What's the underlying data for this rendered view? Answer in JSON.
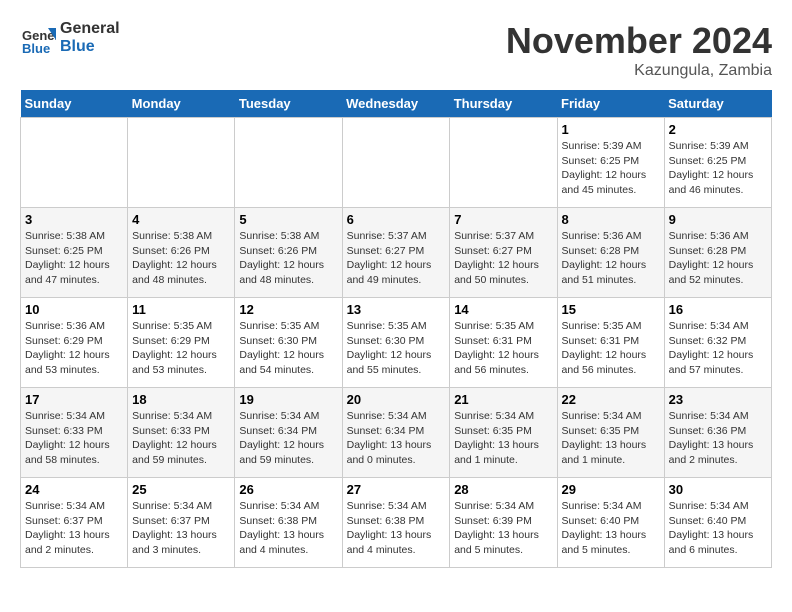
{
  "header": {
    "logo_line1": "General",
    "logo_line2": "Blue",
    "month": "November 2024",
    "location": "Kazungula, Zambia"
  },
  "weekdays": [
    "Sunday",
    "Monday",
    "Tuesday",
    "Wednesday",
    "Thursday",
    "Friday",
    "Saturday"
  ],
  "weeks": [
    [
      {
        "day": "",
        "info": ""
      },
      {
        "day": "",
        "info": ""
      },
      {
        "day": "",
        "info": ""
      },
      {
        "day": "",
        "info": ""
      },
      {
        "day": "",
        "info": ""
      },
      {
        "day": "1",
        "info": "Sunrise: 5:39 AM\nSunset: 6:25 PM\nDaylight: 12 hours\nand 45 minutes."
      },
      {
        "day": "2",
        "info": "Sunrise: 5:39 AM\nSunset: 6:25 PM\nDaylight: 12 hours\nand 46 minutes."
      }
    ],
    [
      {
        "day": "3",
        "info": "Sunrise: 5:38 AM\nSunset: 6:25 PM\nDaylight: 12 hours\nand 47 minutes."
      },
      {
        "day": "4",
        "info": "Sunrise: 5:38 AM\nSunset: 6:26 PM\nDaylight: 12 hours\nand 48 minutes."
      },
      {
        "day": "5",
        "info": "Sunrise: 5:38 AM\nSunset: 6:26 PM\nDaylight: 12 hours\nand 48 minutes."
      },
      {
        "day": "6",
        "info": "Sunrise: 5:37 AM\nSunset: 6:27 PM\nDaylight: 12 hours\nand 49 minutes."
      },
      {
        "day": "7",
        "info": "Sunrise: 5:37 AM\nSunset: 6:27 PM\nDaylight: 12 hours\nand 50 minutes."
      },
      {
        "day": "8",
        "info": "Sunrise: 5:36 AM\nSunset: 6:28 PM\nDaylight: 12 hours\nand 51 minutes."
      },
      {
        "day": "9",
        "info": "Sunrise: 5:36 AM\nSunset: 6:28 PM\nDaylight: 12 hours\nand 52 minutes."
      }
    ],
    [
      {
        "day": "10",
        "info": "Sunrise: 5:36 AM\nSunset: 6:29 PM\nDaylight: 12 hours\nand 53 minutes."
      },
      {
        "day": "11",
        "info": "Sunrise: 5:35 AM\nSunset: 6:29 PM\nDaylight: 12 hours\nand 53 minutes."
      },
      {
        "day": "12",
        "info": "Sunrise: 5:35 AM\nSunset: 6:30 PM\nDaylight: 12 hours\nand 54 minutes."
      },
      {
        "day": "13",
        "info": "Sunrise: 5:35 AM\nSunset: 6:30 PM\nDaylight: 12 hours\nand 55 minutes."
      },
      {
        "day": "14",
        "info": "Sunrise: 5:35 AM\nSunset: 6:31 PM\nDaylight: 12 hours\nand 56 minutes."
      },
      {
        "day": "15",
        "info": "Sunrise: 5:35 AM\nSunset: 6:31 PM\nDaylight: 12 hours\nand 56 minutes."
      },
      {
        "day": "16",
        "info": "Sunrise: 5:34 AM\nSunset: 6:32 PM\nDaylight: 12 hours\nand 57 minutes."
      }
    ],
    [
      {
        "day": "17",
        "info": "Sunrise: 5:34 AM\nSunset: 6:33 PM\nDaylight: 12 hours\nand 58 minutes."
      },
      {
        "day": "18",
        "info": "Sunrise: 5:34 AM\nSunset: 6:33 PM\nDaylight: 12 hours\nand 59 minutes."
      },
      {
        "day": "19",
        "info": "Sunrise: 5:34 AM\nSunset: 6:34 PM\nDaylight: 12 hours\nand 59 minutes."
      },
      {
        "day": "20",
        "info": "Sunrise: 5:34 AM\nSunset: 6:34 PM\nDaylight: 13 hours\nand 0 minutes."
      },
      {
        "day": "21",
        "info": "Sunrise: 5:34 AM\nSunset: 6:35 PM\nDaylight: 13 hours\nand 1 minute."
      },
      {
        "day": "22",
        "info": "Sunrise: 5:34 AM\nSunset: 6:35 PM\nDaylight: 13 hours\nand 1 minute."
      },
      {
        "day": "23",
        "info": "Sunrise: 5:34 AM\nSunset: 6:36 PM\nDaylight: 13 hours\nand 2 minutes."
      }
    ],
    [
      {
        "day": "24",
        "info": "Sunrise: 5:34 AM\nSunset: 6:37 PM\nDaylight: 13 hours\nand 2 minutes."
      },
      {
        "day": "25",
        "info": "Sunrise: 5:34 AM\nSunset: 6:37 PM\nDaylight: 13 hours\nand 3 minutes."
      },
      {
        "day": "26",
        "info": "Sunrise: 5:34 AM\nSunset: 6:38 PM\nDaylight: 13 hours\nand 4 minutes."
      },
      {
        "day": "27",
        "info": "Sunrise: 5:34 AM\nSunset: 6:38 PM\nDaylight: 13 hours\nand 4 minutes."
      },
      {
        "day": "28",
        "info": "Sunrise: 5:34 AM\nSunset: 6:39 PM\nDaylight: 13 hours\nand 5 minutes."
      },
      {
        "day": "29",
        "info": "Sunrise: 5:34 AM\nSunset: 6:40 PM\nDaylight: 13 hours\nand 5 minutes."
      },
      {
        "day": "30",
        "info": "Sunrise: 5:34 AM\nSunset: 6:40 PM\nDaylight: 13 hours\nand 6 minutes."
      }
    ]
  ]
}
